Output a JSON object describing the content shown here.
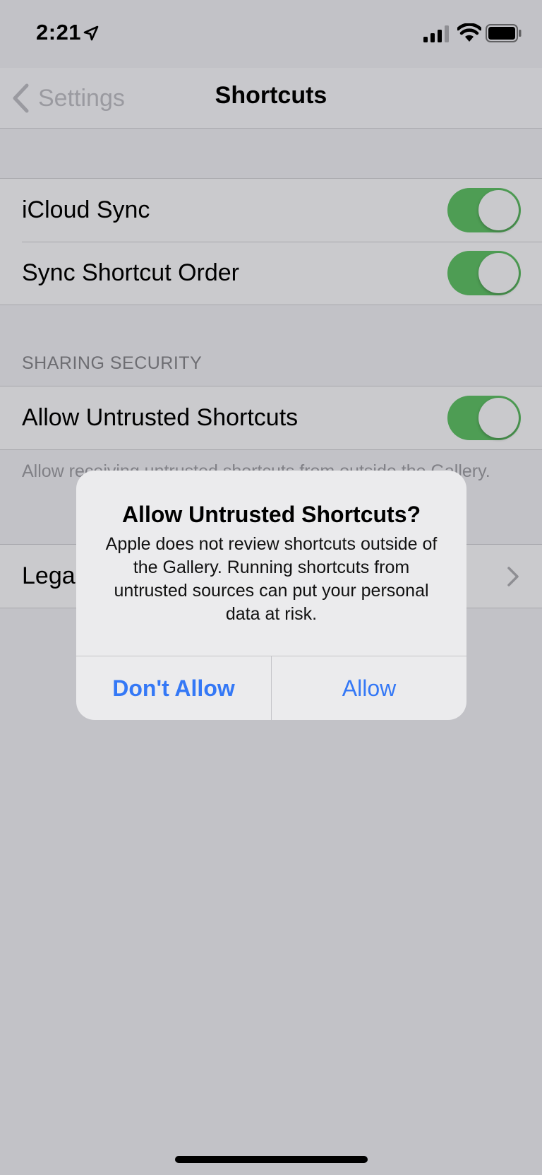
{
  "status_bar": {
    "time": "2:21",
    "location_icon": "location-arrow-icon",
    "signal_icon": "cellular-signal-icon",
    "wifi_icon": "wifi-icon",
    "battery_icon": "battery-icon"
  },
  "nav": {
    "back_label": "Settings",
    "title": "Shortcuts"
  },
  "sync_group": {
    "items": [
      {
        "label": "iCloud Sync",
        "toggle_on": true
      },
      {
        "label": "Sync Shortcut Order",
        "toggle_on": true
      }
    ]
  },
  "sharing_security": {
    "header": "SHARING SECURITY",
    "item": {
      "label": "Allow Untrusted Shortcuts",
      "toggle_on": true
    },
    "footer": "Allow receiving untrusted shortcuts from outside the Gallery."
  },
  "legal_row": {
    "label": "Legal"
  },
  "alert": {
    "title": "Allow Untrusted Shortcuts?",
    "message": "Apple does not review shortcuts outside of the Gallery. Running shortcuts from untrusted sources can put your personal data at risk.",
    "buttons": {
      "dont_allow": "Don't Allow",
      "allow": "Allow"
    }
  },
  "colors": {
    "toggle_on": "#4e9d54",
    "link_blue": "#3478f6",
    "background": "#c2c2c7"
  }
}
